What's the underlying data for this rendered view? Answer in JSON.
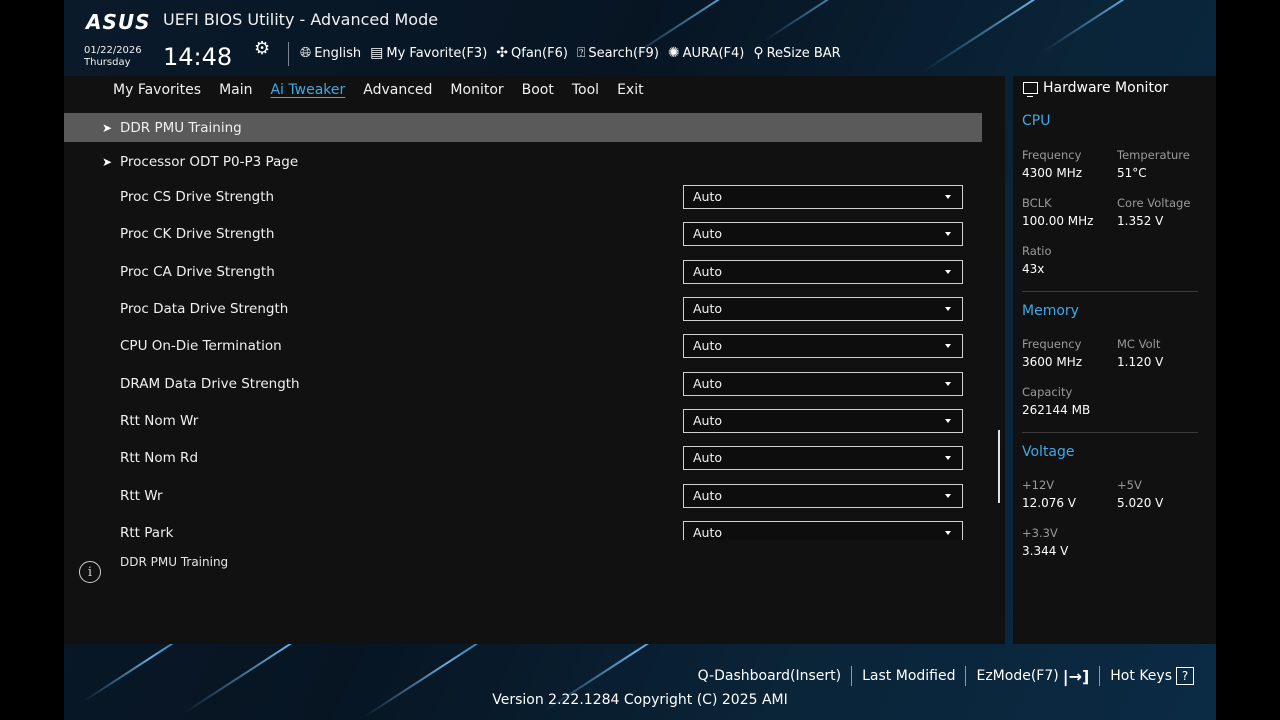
{
  "header": {
    "logo": "ASUS",
    "title": "UEFI BIOS Utility - Advanced Mode",
    "date": "01/22/2026",
    "day": "Thursday",
    "time": "14:48"
  },
  "toolbar": {
    "items": [
      {
        "label": "English",
        "icon": "globe-icon"
      },
      {
        "label": "My Favorite(F3)",
        "icon": "favorite-icon"
      },
      {
        "label": "Qfan(F6)",
        "icon": "fan-icon"
      },
      {
        "label": "Search(F9)",
        "icon": "search-icon"
      },
      {
        "label": "AURA(F4)",
        "icon": "aura-icon"
      },
      {
        "label": "ReSize BAR",
        "icon": "resize-bar-icon"
      }
    ]
  },
  "menu": {
    "tabs": [
      "My Favorites",
      "Main",
      "Ai Tweaker",
      "Advanced",
      "Monitor",
      "Boot",
      "Tool",
      "Exit"
    ],
    "active": "Ai Tweaker"
  },
  "settings": {
    "submenus": [
      {
        "label": "DDR PMU Training",
        "highlighted": true
      },
      {
        "label": "Processor ODT P0-P3 Page",
        "highlighted": false
      }
    ],
    "options": [
      {
        "label": "Proc CS Drive Strength",
        "value": "Auto"
      },
      {
        "label": "Proc CK Drive Strength",
        "value": "Auto"
      },
      {
        "label": "Proc CA Drive Strength",
        "value": "Auto"
      },
      {
        "label": "Proc Data Drive Strength",
        "value": "Auto"
      },
      {
        "label": "CPU On-Die Termination",
        "value": "Auto"
      },
      {
        "label": "DRAM Data Drive Strength",
        "value": "Auto"
      },
      {
        "label": "Rtt Nom Wr",
        "value": "Auto"
      },
      {
        "label": "Rtt Nom Rd",
        "value": "Auto"
      },
      {
        "label": "Rtt Wr",
        "value": "Auto"
      },
      {
        "label": "Rtt Park",
        "value": "Auto"
      }
    ]
  },
  "help": {
    "text": "DDR PMU Training"
  },
  "hardware_monitor": {
    "title": "Hardware Monitor",
    "cpu": {
      "heading": "CPU",
      "frequency_label": "Frequency",
      "frequency": "4300 MHz",
      "temperature_label": "Temperature",
      "temperature": "51°C",
      "bclk_label": "BCLK",
      "bclk": "100.00 MHz",
      "core_voltage_label": "Core Voltage",
      "core_voltage": "1.352 V",
      "ratio_label": "Ratio",
      "ratio": "43x"
    },
    "memory": {
      "heading": "Memory",
      "frequency_label": "Frequency",
      "frequency": "3600 MHz",
      "mc_volt_label": "MC Volt",
      "mc_volt": "1.120 V",
      "capacity_label": "Capacity",
      "capacity": "262144 MB"
    },
    "voltage": {
      "heading": "Voltage",
      "v12_label": "+12V",
      "v12": "12.076 V",
      "v5_label": "+5V",
      "v5": "5.020 V",
      "v33_label": "+3.3V",
      "v33": "3.344 V"
    }
  },
  "footer": {
    "q_dashboard": "Q-Dashboard(Insert)",
    "last_modified": "Last Modified",
    "ezmode": "EzMode(F7)",
    "hot_keys": "Hot Keys",
    "version": "Version 2.22.1284 Copyright (C) 2025 AMI"
  },
  "colors": {
    "accent": "#3fa9e8",
    "panel": "#111111",
    "highlight_row": "#5a5a5a"
  }
}
